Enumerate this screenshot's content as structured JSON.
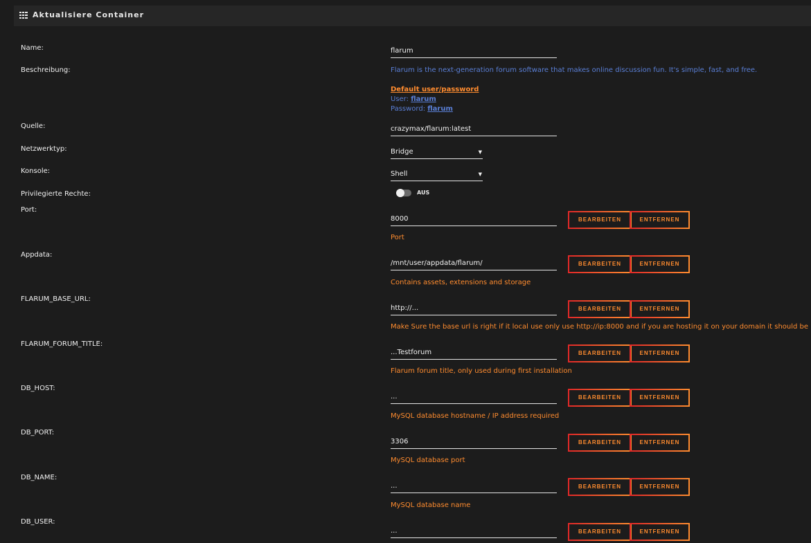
{
  "header": {
    "title": "Aktualisiere Container",
    "icon": "grid-icon"
  },
  "fields": {
    "name": {
      "label": "Name:",
      "value": "flarum"
    },
    "beschreibung": {
      "label": "Beschreibung:",
      "text": "Flarum is the next-generation forum software that makes online discussion fun. It's simple, fast, and free.",
      "default_title": "Default user/password",
      "user_prefix": "User:",
      "user_value": "flarum",
      "password_prefix": "Password:",
      "password_value": "flarum"
    },
    "quelle": {
      "label": "Quelle:",
      "value": "crazymax/flarum:latest"
    },
    "netzwerktyp": {
      "label": "Netzwerktyp:",
      "value": "Bridge"
    },
    "konsole": {
      "label": "Konsole:",
      "value": "Shell"
    },
    "privilegiert": {
      "label": "Privilegierte Rechte:",
      "state": "AUS"
    }
  },
  "buttons": {
    "edit": "BEARBEITEN",
    "remove": "ENTFERNEN"
  },
  "config_rows": [
    {
      "label": "Port:",
      "value": "8000",
      "desc": "Port"
    },
    {
      "label": "Appdata:",
      "value": "/mnt/user/appdata/flarum/",
      "desc": "Contains assets, extensions and storage"
    },
    {
      "label": "FLARUM_BASE_URL:",
      "value": "http://...",
      "desc": "Make Sure the base url is right if it local use only use http://ip:8000 and if you are hosting it on your domain it should be http://ex"
    },
    {
      "label": "FLARUM_FORUM_TITLE:",
      "value": "...Testforum",
      "desc": "Flarum forum title, only used during first installation"
    },
    {
      "label": "DB_HOST:",
      "value": "...",
      "desc": "MySQL database hostname / IP address required"
    },
    {
      "label": "DB_PORT:",
      "value": "3306",
      "desc": "MySQL database port"
    },
    {
      "label": "DB_NAME:",
      "value": "...",
      "desc": "MySQL database name"
    },
    {
      "label": "DB_USER:",
      "value": "...",
      "desc": ""
    }
  ],
  "colors": {
    "accent": "#ff8c2f",
    "button_border_start": "#e22828",
    "link": "#5a7fd6",
    "background": "#1c1c1c"
  }
}
